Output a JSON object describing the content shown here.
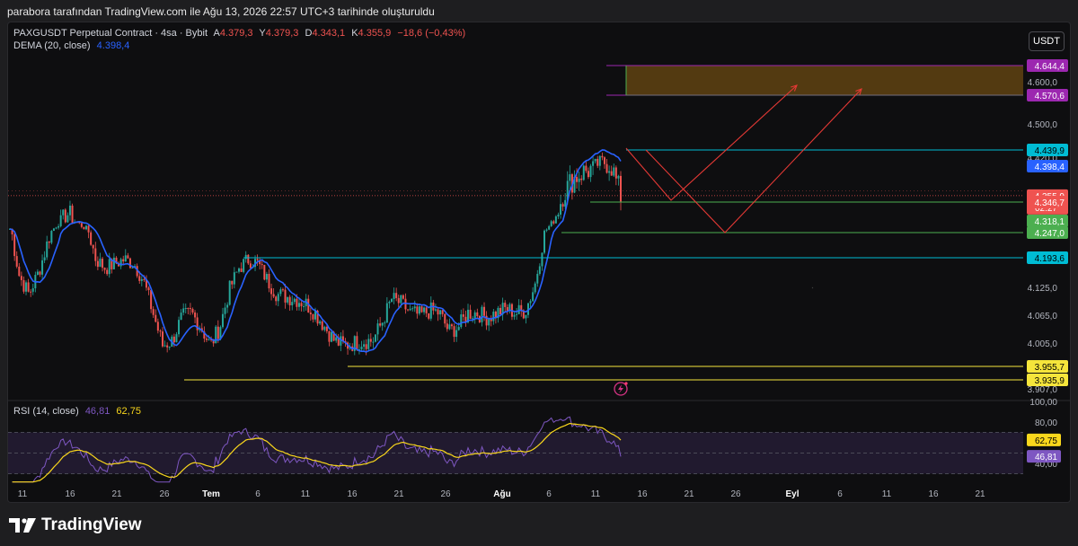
{
  "caption": "parabora tarafından TradingView.com ile Ağu 13, 2026 22:57 UTC+3 tarihinde oluşturuldu",
  "legend": {
    "symbol": "PAXGUSDT Perpetual Contract · 4sa · Bybit",
    "o_label": "A",
    "o_value": "4.379,3",
    "h_label": "Y",
    "h_value": "4.379,3",
    "l_label": "D",
    "l_value": "4.343,1",
    "c_label": "K",
    "c_value": "4.355,9",
    "change": "−18,6 (−0,43%)",
    "dema_label": "DEMA (20, close)",
    "dema_value": "4.398,4",
    "rsi_label": "RSI (14, close)",
    "rsi_value": "46,81",
    "rsi_ma_value": "62,75"
  },
  "currency_button": "USDT",
  "brand": "TradingView",
  "colors": {
    "up": "#26a69a",
    "down": "#ef5350",
    "dema": "#2962ff",
    "rsi": "#7e57c2",
    "rsi_ma": "#f9d71c",
    "cyan": "#00bcd4",
    "green": "#4caf50",
    "yellow": "#f5e53b",
    "purple": "#9c27b0",
    "red_arrow": "#e53935"
  },
  "chart_data": {
    "type": "candlestick",
    "timeframe": "4sa",
    "y_ticks": [
      "4.644,4",
      "4.600,0",
      "4.570,6",
      "4.500,0",
      "4.439,9",
      "4.420,0",
      "4.398,4",
      "4.355,9",
      "02:27",
      "4.346,7",
      "4.318,1",
      "4.247,0",
      "4.193,6",
      "4.125,0",
      "4.065,0",
      "4.005,0",
      "3.955,7",
      "3.935,9",
      "3.907,0"
    ],
    "x_ticks": [
      "11",
      "16",
      "21",
      "26",
      "Tem",
      "6",
      "11",
      "16",
      "21",
      "26",
      "Ağu",
      "6",
      "11",
      "16",
      "21",
      "26",
      "Eyl",
      "6",
      "11",
      "16",
      "21"
    ],
    "ylim": [
      3900,
      4700
    ],
    "price_path": [
      {
        "t": "Haz 10",
        "p": 4270
      },
      {
        "t": "Haz 11",
        "p": 4150
      },
      {
        "t": "Haz 12",
        "p": 4110
      },
      {
        "t": "Haz 13",
        "p": 4160
      },
      {
        "t": "Haz 14",
        "p": 4230
      },
      {
        "t": "Haz 15",
        "p": 4300
      },
      {
        "t": "Haz 16",
        "p": 4330
      },
      {
        "t": "Haz 17",
        "p": 4310
      },
      {
        "t": "Haz 18",
        "p": 4270
      },
      {
        "t": "Haz 19",
        "p": 4190
      },
      {
        "t": "Haz 20",
        "p": 4170
      },
      {
        "t": "Haz 21",
        "p": 4180
      },
      {
        "t": "Haz 22",
        "p": 4190
      },
      {
        "t": "Haz 23",
        "p": 4180
      },
      {
        "t": "Haz 24",
        "p": 4140
      },
      {
        "t": "Haz 25",
        "p": 4070
      },
      {
        "t": "Haz 26",
        "p": 4000
      },
      {
        "t": "Haz 27",
        "p": 4010
      },
      {
        "t": "Haz 28",
        "p": 4060
      },
      {
        "t": "Haz 29",
        "p": 4070
      },
      {
        "t": "Haz 30",
        "p": 4040
      },
      {
        "t": "Tem 1",
        "p": 4000
      },
      {
        "t": "Tem 2",
        "p": 4040
      },
      {
        "t": "Tem 3",
        "p": 4120
      },
      {
        "t": "Tem 4",
        "p": 4170
      },
      {
        "t": "Tem 5",
        "p": 4190
      },
      {
        "t": "Tem 6",
        "p": 4180
      },
      {
        "t": "Tem 7",
        "p": 4140
      },
      {
        "t": "Tem 8",
        "p": 4110
      },
      {
        "t": "Tem 9",
        "p": 4105
      },
      {
        "t": "Tem 10",
        "p": 4100
      },
      {
        "t": "Tem 11",
        "p": 4090
      },
      {
        "t": "Tem 12",
        "p": 4070
      },
      {
        "t": "Tem 13",
        "p": 4040
      },
      {
        "t": "Tem 14",
        "p": 4010
      },
      {
        "t": "Tem 15",
        "p": 4000
      },
      {
        "t": "Tem 16",
        "p": 4005
      },
      {
        "t": "Tem 17",
        "p": 4010
      },
      {
        "t": "Tem 18",
        "p": 4010
      },
      {
        "t": "Tem 19",
        "p": 4050
      },
      {
        "t": "Tem 20",
        "p": 4100
      },
      {
        "t": "Tem 21",
        "p": 4090
      },
      {
        "t": "Tem 22",
        "p": 4070
      },
      {
        "t": "Tem 23",
        "p": 4065
      },
      {
        "t": "Tem 24",
        "p": 4075
      },
      {
        "t": "Tem 25",
        "p": 4070
      },
      {
        "t": "Tem 26",
        "p": 4030
      },
      {
        "t": "Tem 27",
        "p": 4040
      },
      {
        "t": "Tem 28",
        "p": 4070
      },
      {
        "t": "Tem 29",
        "p": 4070
      },
      {
        "t": "Tem 30",
        "p": 4060
      },
      {
        "t": "Tem 31",
        "p": 4070
      },
      {
        "t": "Ağu 1",
        "p": 4080
      },
      {
        "t": "Ağu 2",
        "p": 4070
      },
      {
        "t": "Ağu 3",
        "p": 4075
      },
      {
        "t": "Ağu 4",
        "p": 4130
      },
      {
        "t": "Ağu 5",
        "p": 4250
      },
      {
        "t": "Ağu 6",
        "p": 4320
      },
      {
        "t": "Ağu 7",
        "p": 4360
      },
      {
        "t": "Ağu 8",
        "p": 4380
      },
      {
        "t": "Ağu 9",
        "p": 4390
      },
      {
        "t": "Ağu 10",
        "p": 4395
      },
      {
        "t": "Ağu 11",
        "p": 4410
      },
      {
        "t": "Ağu 12",
        "p": 4400
      },
      {
        "t": "Ağu 13",
        "p": 4356
      }
    ],
    "horizontal_levels": [
      {
        "value": 4439.9,
        "label": "4.439,9",
        "color": "cyan"
      },
      {
        "value": 4346.7,
        "label": "4.346,7",
        "color": "green"
      },
      {
        "value": 4247.0,
        "label": "4.247,0",
        "color": "green"
      },
      {
        "value": 4193.6,
        "label": "4.193,6",
        "color": "cyan"
      },
      {
        "value": 3955.7,
        "label": "3.955,7",
        "color": "yellow"
      },
      {
        "value": 3935.9,
        "label": "3.935,9",
        "color": "yellow"
      }
    ],
    "target_zone": {
      "from": 4570.6,
      "to": 4644.4,
      "labels": [
        "4.570,6",
        "4.644,4"
      ]
    },
    "markers": [
      {
        "label": "4.398,4",
        "value": 4398.4,
        "kind": "dema"
      },
      {
        "label": "4.355,9",
        "value": 4355.9,
        "kind": "last"
      },
      {
        "label": "4.318,1",
        "value": 4318.1,
        "kind": "green"
      }
    ],
    "rsi": {
      "ticks": [
        "100,00",
        "80,00",
        "62,75",
        "46,81",
        "40,00"
      ],
      "value": 46.81,
      "ma": 62.75,
      "band": [
        30,
        70
      ]
    }
  }
}
